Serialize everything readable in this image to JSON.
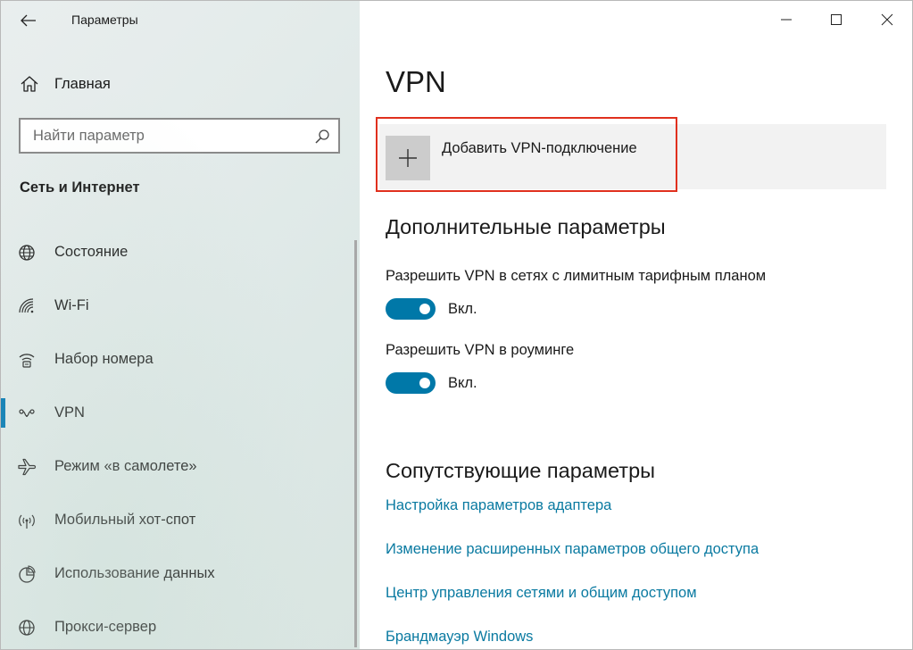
{
  "window": {
    "title": "Параметры",
    "controls": [
      "minimize",
      "maximize",
      "close"
    ]
  },
  "sidebar": {
    "home_label": "Главная",
    "search": {
      "placeholder": "Найти параметр",
      "value": ""
    },
    "section_title": "Сеть и Интернет",
    "items": [
      {
        "label": "Состояние",
        "icon": "globe-icon",
        "selected": false
      },
      {
        "label": "Wi-Fi",
        "icon": "wifi-icon",
        "selected": false
      },
      {
        "label": "Набор номера",
        "icon": "dialup-icon",
        "selected": false
      },
      {
        "label": "VPN",
        "icon": "vpn-icon",
        "selected": true
      },
      {
        "label": "Режим «в самолете»",
        "icon": "airplane-icon",
        "selected": false
      },
      {
        "label": "Мобильный хот-спот",
        "icon": "hotspot-icon",
        "selected": false
      },
      {
        "label": "Использование данных",
        "icon": "data-usage-icon",
        "selected": false
      },
      {
        "label": "Прокси-сервер",
        "icon": "proxy-globe-icon",
        "selected": false
      }
    ]
  },
  "main": {
    "title": "VPN",
    "add_vpn_label": "Добавить VPN-подключение",
    "advanced": {
      "heading": "Дополнительные параметры",
      "settings": [
        {
          "label": "Разрешить VPN в сетях с лимитным тарифным планом",
          "state": "Вкл.",
          "on": true
        },
        {
          "label": "Разрешить VPN в роуминге",
          "state": "Вкл.",
          "on": true
        }
      ]
    },
    "related": {
      "heading": "Сопутствующие параметры",
      "links": [
        "Настройка параметров адаптера",
        "Изменение расширенных параметров общего доступа",
        "Центр управления сетями и общим доступом",
        "Брандмауэр Windows"
      ]
    }
  },
  "colors": {
    "accent": "#0078a8",
    "link": "#0a7aa1",
    "highlight_border": "#e0301e",
    "selected_indicator": "#0077b3"
  }
}
